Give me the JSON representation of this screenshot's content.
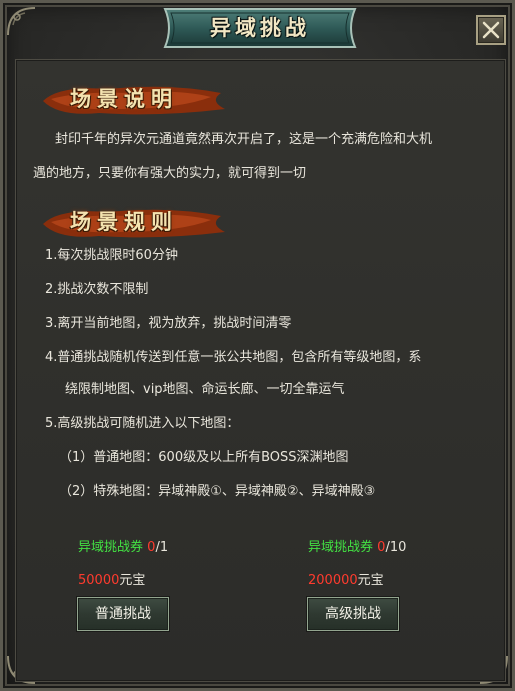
{
  "window": {
    "title": "异域挑战",
    "colors": {
      "title_banner": "#2f5a57",
      "panel": "#2e2e2b",
      "accent_green": "#43e143",
      "accent_red": "#ff3b2e"
    }
  },
  "close_icon": "close-icon",
  "section_description": {
    "heading": "场景说明",
    "line1": "封印千年的异次元通道竟然再次开启了，这是一个充满危险和大机",
    "line2": "遇的地方，只要你有强大的实力，就可得到一切"
  },
  "section_rules": {
    "heading": "场景规则",
    "items": [
      "1.每次挑战限时60分钟",
      "2.挑战次数不限制",
      "3.离开当前地图，视为放弃，挑战时间清零",
      "4.普通挑战随机传送到任意一张公共地图，包含所有等级地图，系",
      "绕限制地图、vip地图、命运长廊、一切全靠运气",
      "5.高级挑战可随机进入以下地图：",
      "（1）普通地图：600级及以上所有BOSS深渊地图",
      "（2）特殊地图：异域神殿①、异域神殿②、异域神殿③"
    ]
  },
  "normal_challenge": {
    "ticket_label": "异域挑战券",
    "ticket_have": "0",
    "ticket_need": "/1",
    "cost_amount": "50000",
    "cost_unit": "元宝",
    "button_label": "普通挑战"
  },
  "advanced_challenge": {
    "ticket_label": "异域挑战券",
    "ticket_have": "0",
    "ticket_need": "/10",
    "cost_amount": "200000",
    "cost_unit": "元宝",
    "button_label": "高级挑战"
  }
}
